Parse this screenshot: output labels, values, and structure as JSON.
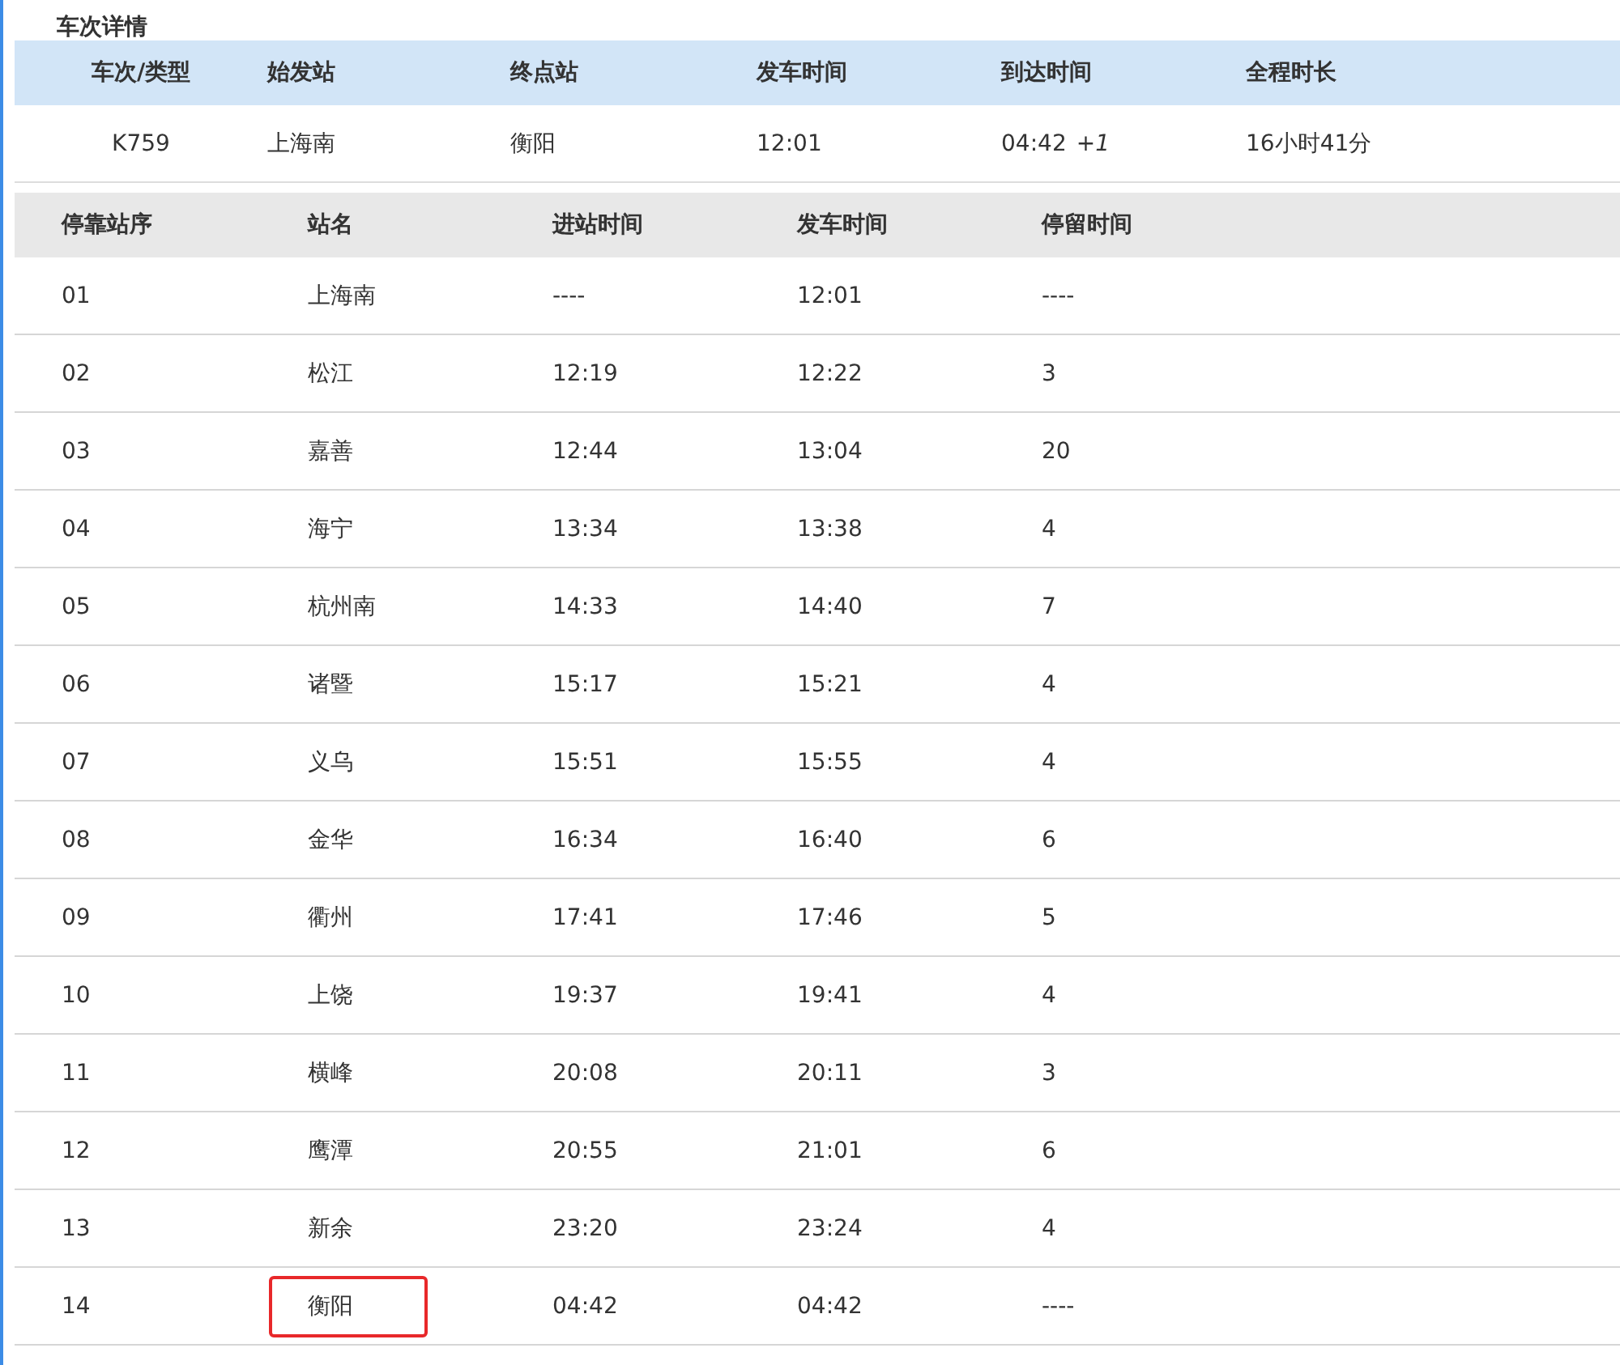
{
  "section_title": "车次详情",
  "summary": {
    "columns": [
      "车次/类型",
      "始发站",
      "终点站",
      "发车时间",
      "到达时间",
      "全程时长"
    ],
    "row": {
      "train": "K759",
      "origin": "上海南",
      "terminus": "衡阳",
      "departure": "12:01",
      "arrival": "04:42",
      "day_offset": "+1",
      "duration": "16小时41分"
    }
  },
  "stops": {
    "columns": [
      "停靠站序",
      "站名",
      "进站时间",
      "发车时间",
      "停留时间"
    ],
    "rows": [
      {
        "seq": "01",
        "station": "上海南",
        "arrive": "----",
        "depart": "12:01",
        "stay": "----",
        "highlighted": false
      },
      {
        "seq": "02",
        "station": "松江",
        "arrive": "12:19",
        "depart": "12:22",
        "stay": "3",
        "highlighted": false
      },
      {
        "seq": "03",
        "station": "嘉善",
        "arrive": "12:44",
        "depart": "13:04",
        "stay": "20",
        "highlighted": false
      },
      {
        "seq": "04",
        "station": "海宁",
        "arrive": "13:34",
        "depart": "13:38",
        "stay": "4",
        "highlighted": false
      },
      {
        "seq": "05",
        "station": "杭州南",
        "arrive": "14:33",
        "depart": "14:40",
        "stay": "7",
        "highlighted": false
      },
      {
        "seq": "06",
        "station": "诸暨",
        "arrive": "15:17",
        "depart": "15:21",
        "stay": "4",
        "highlighted": false
      },
      {
        "seq": "07",
        "station": "义乌",
        "arrive": "15:51",
        "depart": "15:55",
        "stay": "4",
        "highlighted": false
      },
      {
        "seq": "08",
        "station": "金华",
        "arrive": "16:34",
        "depart": "16:40",
        "stay": "6",
        "highlighted": false
      },
      {
        "seq": "09",
        "station": "衢州",
        "arrive": "17:41",
        "depart": "17:46",
        "stay": "5",
        "highlighted": false
      },
      {
        "seq": "10",
        "station": "上饶",
        "arrive": "19:37",
        "depart": "19:41",
        "stay": "4",
        "highlighted": false
      },
      {
        "seq": "11",
        "station": "横峰",
        "arrive": "20:08",
        "depart": "20:11",
        "stay": "3",
        "highlighted": false
      },
      {
        "seq": "12",
        "station": "鹰潭",
        "arrive": "20:55",
        "depart": "21:01",
        "stay": "6",
        "highlighted": false
      },
      {
        "seq": "13",
        "station": "新余",
        "arrive": "23:20",
        "depart": "23:24",
        "stay": "4",
        "highlighted": false
      },
      {
        "seq": "14",
        "station": "衡阳",
        "arrive": "04:42",
        "depart": "04:42",
        "stay": "----",
        "highlighted": true
      }
    ]
  }
}
